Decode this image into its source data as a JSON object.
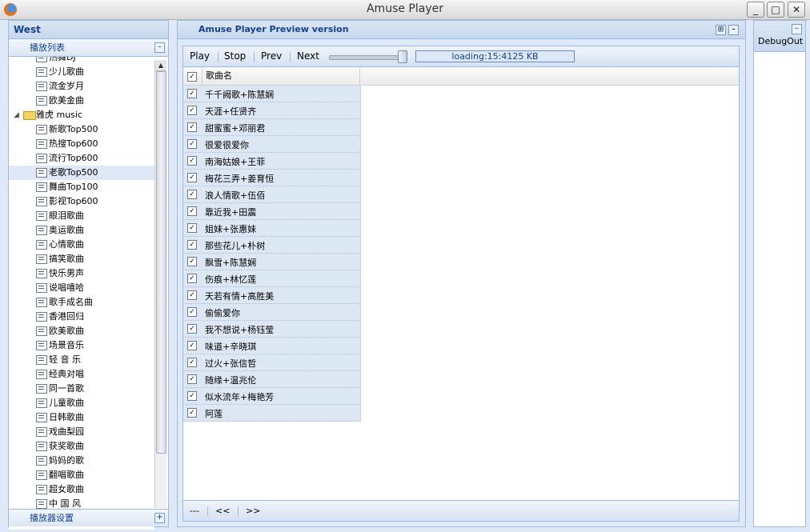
{
  "window": {
    "title": "Amuse Player",
    "controls": [
      "_",
      "□",
      "✕"
    ]
  },
  "west": {
    "title": "West",
    "playlist_header": "播放列表",
    "collapse_glyph": "–",
    "tree": [
      {
        "label": "热舞DJ",
        "type": "leaf"
      },
      {
        "label": "少儿歌曲",
        "type": "leaf"
      },
      {
        "label": "流金岁月",
        "type": "leaf"
      },
      {
        "label": "欧美金曲",
        "type": "leaf"
      },
      {
        "label": "雅虎 music",
        "type": "folder",
        "expanded": true
      },
      {
        "label": "新歌Top500",
        "type": "leaf"
      },
      {
        "label": "热搜Top600",
        "type": "leaf"
      },
      {
        "label": "流行Top600",
        "type": "leaf"
      },
      {
        "label": "老歌Top500",
        "type": "leaf",
        "selected": true
      },
      {
        "label": "舞曲Top100",
        "type": "leaf"
      },
      {
        "label": "影视Top600",
        "type": "leaf"
      },
      {
        "label": "眼泪歌曲",
        "type": "leaf"
      },
      {
        "label": "奥运歌曲",
        "type": "leaf"
      },
      {
        "label": "心情歌曲",
        "type": "leaf"
      },
      {
        "label": "搞笑歌曲",
        "type": "leaf"
      },
      {
        "label": "快乐男声",
        "type": "leaf"
      },
      {
        "label": "说唱嘻哈",
        "type": "leaf"
      },
      {
        "label": "歌手成名曲",
        "type": "leaf"
      },
      {
        "label": "香港回归",
        "type": "leaf"
      },
      {
        "label": "欧美歌曲",
        "type": "leaf"
      },
      {
        "label": "场景音乐",
        "type": "leaf"
      },
      {
        "label": "轻 音 乐",
        "type": "leaf"
      },
      {
        "label": "经典对唱",
        "type": "leaf"
      },
      {
        "label": "同一首歌",
        "type": "leaf"
      },
      {
        "label": "儿童歌曲",
        "type": "leaf"
      },
      {
        "label": "日韩歌曲",
        "type": "leaf"
      },
      {
        "label": "戏曲梨园",
        "type": "leaf"
      },
      {
        "label": "获奖歌曲",
        "type": "leaf"
      },
      {
        "label": "妈妈的歌",
        "type": "leaf"
      },
      {
        "label": "翻唱歌曲",
        "type": "leaf"
      },
      {
        "label": "超女歌曲",
        "type": "leaf"
      },
      {
        "label": "中 国 风",
        "type": "leaf"
      }
    ],
    "settings_header": "播放器设置",
    "expand_glyph": "+",
    "scroll_up_glyph": "▲"
  },
  "center": {
    "title": "Amuse Player Preview version",
    "header_tools": [
      "⊞",
      "–"
    ],
    "toolbar": {
      "play": "Play",
      "stop": "Stop",
      "prev": "Prev",
      "next": "Next",
      "volume_level": 0.95,
      "progress_text": "loading:15:4125 KB"
    },
    "grid": {
      "column_header": "歌曲名",
      "header_checked": true,
      "rows": [
        "千千阙歌+陈慧娴",
        "天涯+任贤齐",
        "甜蜜蜜+邓丽君",
        "很爱很爱你",
        "南海姑娘+王菲",
        "梅花三弄+姜育恒",
        "浪人情歌+伍佰",
        "靠近我+田震",
        "姐妹+张惠妹",
        "那些花儿+朴树",
        "飘雪+陈慧娴",
        "伤痕+林忆莲",
        "天若有情+高胜美",
        "偷偷爱你",
        "我不想说+杨钰莹",
        "味道+辛晓琪",
        "过火+张信哲",
        "随缘+温兆伦",
        "似水流年+梅艳芳",
        "阿莲"
      ],
      "check_glyph": "✓"
    },
    "pager": {
      "page": "---",
      "prev": "<<",
      "next": ">>"
    }
  },
  "east": {
    "title": "DebugOut",
    "collapse_glyph": "–"
  }
}
